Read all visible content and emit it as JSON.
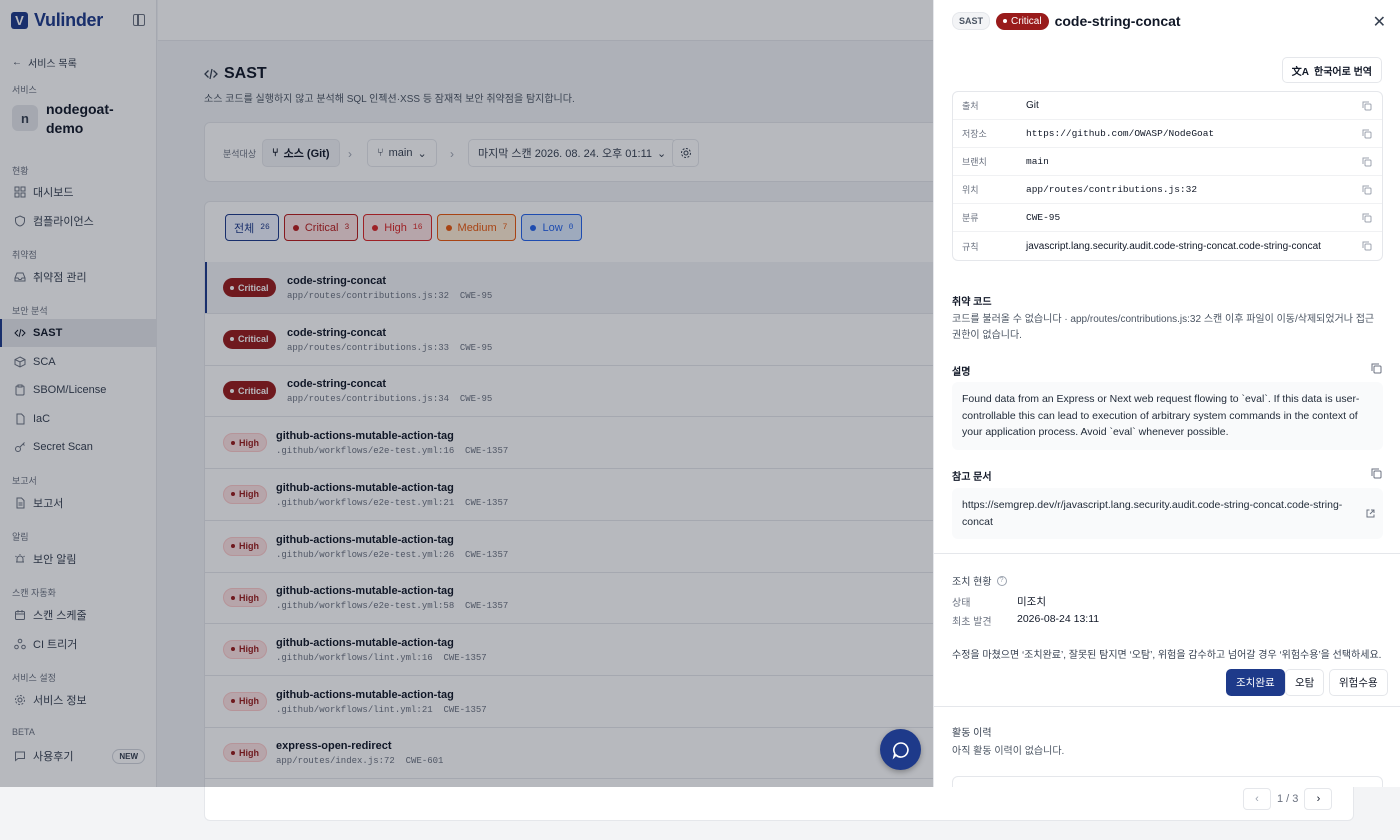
{
  "app": {
    "name": "Vulinder",
    "logo_letter": "V"
  },
  "sidebar": {
    "back_label": "서비스 목록",
    "service_section": "서비스",
    "service_avatar": "n",
    "service_name": "nodegoat-demo",
    "sections": {
      "status": "현황",
      "vuln": "취약점",
      "security": "보안 분석",
      "report": "보고서",
      "alert": "알림",
      "automation": "스캔 자동화",
      "settings": "서비스 설정",
      "beta": "BETA"
    },
    "items": {
      "dashboard": "대시보드",
      "compliance": "컴플라이언스",
      "vuln_mgmt": "취약점 관리",
      "sast": "SAST",
      "sca": "SCA",
      "sbom": "SBOM/License",
      "iac": "IaC",
      "secret": "Secret Scan",
      "report": "보고서",
      "alert": "보안 알림",
      "schedule": "스캔 스케줄",
      "ci": "CI 트리거",
      "info": "서비스 정보",
      "review": "사용후기"
    },
    "new_badge": "NEW"
  },
  "main": {
    "title": "SAST",
    "description": "소스 코드를 실행하지 않고 분석해 SQL 인젝션·XSS 등 잠재적 보안 취약점을 탐지합니다.",
    "filter": {
      "label": "분석대상",
      "source": "소스 (Git)",
      "branch": "main",
      "scan": "마지막 스캔 2026. 08. 24. 오후 01:11"
    },
    "tabs": [
      {
        "label": "전체",
        "count": "26",
        "color": "#1e3a8a"
      },
      {
        "label": "Critical",
        "count": "3",
        "color": "#b91c1c"
      },
      {
        "label": "High",
        "count": "16",
        "color": "#dc2626"
      },
      {
        "label": "Medium",
        "count": "7",
        "color": "#ea580c"
      },
      {
        "label": "Low",
        "count": "0",
        "color": "#2563eb"
      }
    ],
    "rows": [
      {
        "severity": "Critical",
        "title": "code-string-concat",
        "path": "app/routes/contributions.js:32",
        "cwe": "CWE-95"
      },
      {
        "severity": "Critical",
        "title": "code-string-concat",
        "path": "app/routes/contributions.js:33",
        "cwe": "CWE-95"
      },
      {
        "severity": "Critical",
        "title": "code-string-concat",
        "path": "app/routes/contributions.js:34",
        "cwe": "CWE-95"
      },
      {
        "severity": "High",
        "title": "github-actions-mutable-action-tag",
        "path": ".github/workflows/e2e-test.yml:16",
        "cwe": "CWE-1357"
      },
      {
        "severity": "High",
        "title": "github-actions-mutable-action-tag",
        "path": ".github/workflows/e2e-test.yml:21",
        "cwe": "CWE-1357"
      },
      {
        "severity": "High",
        "title": "github-actions-mutable-action-tag",
        "path": ".github/workflows/e2e-test.yml:26",
        "cwe": "CWE-1357"
      },
      {
        "severity": "High",
        "title": "github-actions-mutable-action-tag",
        "path": ".github/workflows/e2e-test.yml:58",
        "cwe": "CWE-1357"
      },
      {
        "severity": "High",
        "title": "github-actions-mutable-action-tag",
        "path": ".github/workflows/lint.yml:16",
        "cwe": "CWE-1357"
      },
      {
        "severity": "High",
        "title": "github-actions-mutable-action-tag",
        "path": ".github/workflows/lint.yml:21",
        "cwe": "CWE-1357"
      },
      {
        "severity": "High",
        "title": "express-open-redirect",
        "path": "app/routes/index.js:72",
        "cwe": "CWE-601"
      }
    ],
    "pager": "1 / 3"
  },
  "drawer": {
    "tag": "SAST",
    "severity": "Critical",
    "title": "code-string-concat",
    "translate": "한국어로 번역",
    "meta": [
      {
        "key": "출처",
        "value": "Git",
        "mono": false
      },
      {
        "key": "저장소",
        "value": "https://github.com/OWASP/NodeGoat",
        "mono": true
      },
      {
        "key": "브랜치",
        "value": "main",
        "mono": true
      },
      {
        "key": "위치",
        "value": "app/routes/contributions.js:32",
        "mono": true
      },
      {
        "key": "분류",
        "value": "CWE-95",
        "mono": true
      },
      {
        "key": "규칙",
        "value": "javascript.lang.security.audit.code-string-concat.code-string-concat",
        "mono": false
      }
    ],
    "vuln_code_title": "취약 코드",
    "vuln_code_msg": "코드를 불러올 수 없습니다 · app/routes/contributions.js:32 스캔 이후 파일이 이동/삭제되었거나 접근 권한이 없습니다.",
    "desc_title": "설명",
    "description": "Found data from an Express or Next web request flowing to `eval`. If this data is user-controllable this can lead to execution of arbitrary system commands in the context of your application process. Avoid `eval` whenever possible.",
    "ref_title": "참고 문서",
    "ref_url": "https://semgrep.dev/r/javascript.lang.security.audit.code-string-concat.code-string-concat",
    "action_title": "조치 현황",
    "status_key": "상태",
    "status_value": "미조치",
    "first_found_key": "최초 발견",
    "first_found_value": "2026-08-24 13:11",
    "action_note": "수정을 마쳤으면 ‘조치완료’, 잘못된 탐지면 ‘오탐’, 위험을 감수하고 넘어갈 경우 ‘위험수용’을 선택하세요.",
    "btn_resolved": "조치완료",
    "btn_fp": "오탐",
    "btn_accept": "위험수용",
    "history_title": "활동 이력",
    "history_empty": "아직 활동 이력이 없습니다."
  },
  "colors": {
    "brand": "#1e3a8a",
    "critical": "#991b1b"
  }
}
